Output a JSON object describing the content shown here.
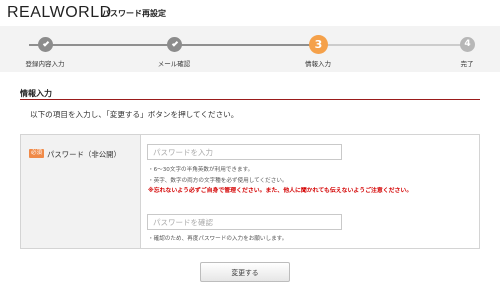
{
  "header": {
    "logo": "REALWORLD",
    "page_title": "パスワード再設定"
  },
  "steps": [
    {
      "number": "1",
      "label": "登録内容入力",
      "status": "done"
    },
    {
      "number": "2",
      "label": "メール確認",
      "status": "done"
    },
    {
      "number": "3",
      "label": "情報入力",
      "status": "current"
    },
    {
      "number": "4",
      "label": "完了",
      "status": "future"
    }
  ],
  "section": {
    "title": "情報入力",
    "instruction": "以下の項目を入力し、「変更する」ボタンを押してください。"
  },
  "form": {
    "required_badge": "必須",
    "password_label": "パスワード（非公開）",
    "password_placeholder": "パスワードを入力",
    "password_value": "",
    "note1": "・6～30文字の半角英数が利用できます。",
    "note2": "・英字、数字の両方の文字種を必ず使用してください。",
    "warning": "※忘れないよう必ずご自身で管理ください。また、他人に聞かれても伝えないようご注意ください。",
    "confirm_placeholder": "パスワードを確認",
    "confirm_value": "",
    "note3": "・確認のため、再度パスワードの入力をお願いします。"
  },
  "submit_label": "変更する",
  "colors": {
    "accent_orange": "#f5a14a",
    "rule_red": "#9a1b1b",
    "warning_red": "#d40000",
    "badge_orange": "#f08a48"
  }
}
